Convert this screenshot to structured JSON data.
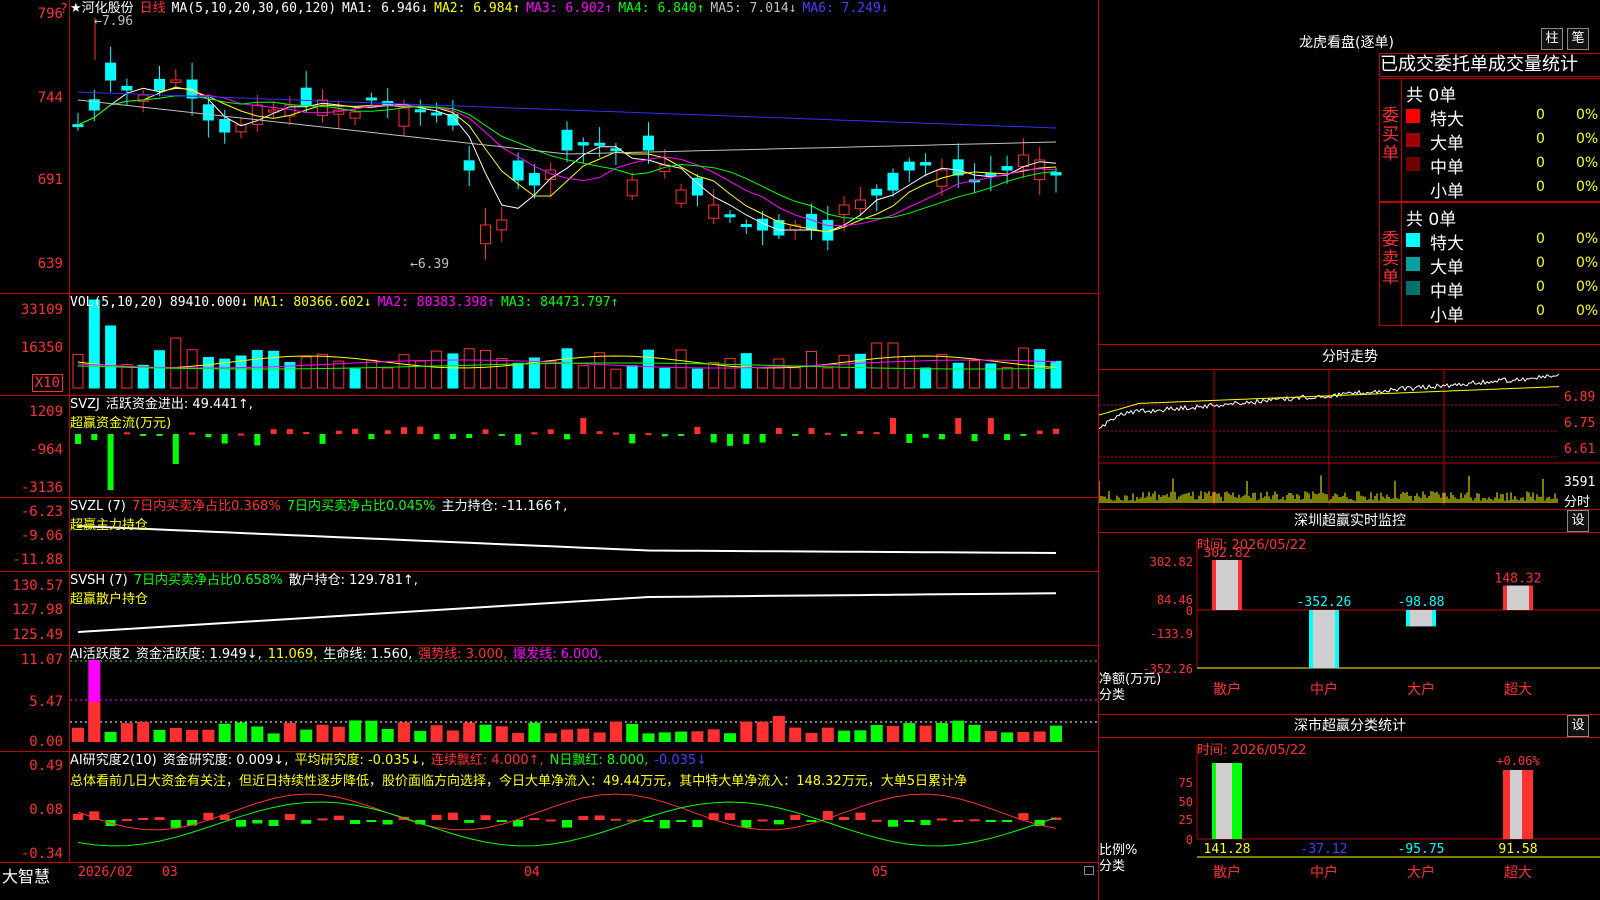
{
  "stock": {
    "name": "★河化股份",
    "period": "日线",
    "ma_label": "MA(5,10,20,30,60,120)",
    "ma": [
      {
        "label": "MA1: 6.946↓",
        "color": "#ffffff"
      },
      {
        "label": "MA2: 6.984↑",
        "color": "#ffff00"
      },
      {
        "label": "MA3: 6.902↑",
        "color": "#ff00ff"
      },
      {
        "label": "MA4: 6.840↑",
        "color": "#00ff00"
      },
      {
        "label": "MA5: 7.014↓",
        "color": "#c0c0c0"
      },
      {
        "label": "MA6: 7.249↓",
        "color": "#4040ff"
      }
    ],
    "price_ticks": [
      "796",
      "744",
      "691",
      "639"
    ],
    "high_note": "←7.96",
    "low_note": "←6.39"
  },
  "vol": {
    "label": "VOL(5,10,20)",
    "value": "89410.000↓",
    "ma": [
      {
        "label": "MA1: 80366.602↓",
        "color": "#ffff00"
      },
      {
        "label": "MA2: 80383.398↑",
        "color": "#ff00ff"
      },
      {
        "label": "MA3: 84473.797↑",
        "color": "#00ff00"
      }
    ],
    "ticks": [
      "33109",
      "16350"
    ],
    "unit": "X10"
  },
  "svzj": {
    "label": "SVZJ",
    "title": "活跃资金进出: 49.441↑,",
    "sub": "超赢资金流(万元)",
    "ticks": [
      "1209",
      "-964",
      "-3136"
    ]
  },
  "svzl": {
    "label": "SVZL (7)",
    "a": "7日内买卖净占比0.368%",
    "b": "7日内买卖净占比0.045%",
    "c": "主力持仓: -11.166↑,",
    "sub": "超赢主力持仓",
    "ticks": [
      "-6.23",
      "-9.06",
      "-11.88"
    ]
  },
  "svsh": {
    "label": "SVSH (7)",
    "a": "7日内买卖净占比0.658%",
    "c": "散户持仓: 129.781↑,",
    "sub": "超赢散户持仓",
    "ticks": [
      "130.57",
      "127.98",
      "125.49"
    ]
  },
  "ai1": {
    "label": "AI活跃度2",
    "a": "资金活跃度: 1.949↓,",
    "b": "11.069,",
    "c": "生命线: 1.560,",
    "d": "强势线: 3.000,",
    "e": "爆发线: 6.000,",
    "ticks": [
      "11.07",
      "5.47",
      "0.00"
    ]
  },
  "ai2": {
    "label": "AI研究度2(10)",
    "a": "资金研究度: 0.009↓,",
    "b": "平均研究度: -0.035↓,",
    "c": "连续飘红: 4.000↑,",
    "d": "N日飘红: 8.000,",
    "e": "-0.035↓",
    "comment": "总体看前几日大资金有关注，但近日持续性逐步降低，股价面临方向选择，今日大单净流入：49.44万元，其中特大单净流入：148.32万元，大单5日累计净",
    "ticks": [
      "0.49",
      "0.08",
      "-0.34"
    ]
  },
  "bottom": {
    "brand": "大智慧",
    "dates": [
      "2026/02",
      "03",
      "04",
      "05"
    ]
  },
  "dragon": {
    "title": "龙虎看盘(逐单)",
    "btn1": "柱",
    "btn2": "笔",
    "subtitle": "已成交委托单成交量统计",
    "buy": {
      "side": "委买单",
      "total": "共 0单",
      "rows": [
        {
          "name": "特大",
          "val": "0",
          "pct": "0%",
          "color": "#ff0000"
        },
        {
          "name": "大单",
          "val": "0",
          "pct": "0%",
          "color": "#a00000"
        },
        {
          "name": "中单",
          "val": "0",
          "pct": "0%",
          "color": "#700000"
        },
        {
          "name": "小单",
          "val": "0",
          "pct": "0%",
          "color": "#000000"
        }
      ]
    },
    "sell": {
      "side": "委卖单",
      "total": "共 0单",
      "rows": [
        {
          "name": "特大",
          "val": "0",
          "pct": "0%",
          "color": "#00ffff"
        },
        {
          "name": "大单",
          "val": "0",
          "pct": "0%",
          "color": "#00a0a0"
        },
        {
          "name": "中单",
          "val": "0",
          "pct": "0%",
          "color": "#007070"
        },
        {
          "name": "小单",
          "val": "0",
          "pct": "0%",
          "color": "#000000"
        }
      ]
    }
  },
  "intraday": {
    "title": "分时走势",
    "ticks": [
      "6.89",
      "6.75",
      "6.61"
    ],
    "vol_tick": "3591",
    "vol_label": "分时"
  },
  "sz_monitor": {
    "title": "深圳超赢实时监控",
    "btn": "设",
    "time": "时间: 2026/05/22",
    "ticks": [
      "302.82",
      "84.46",
      "0",
      "-133.9",
      "-352.26"
    ],
    "ylabel": "净额(万元)",
    "xlabel": "分类",
    "bars": [
      {
        "cat": "散户",
        "val": 302.82,
        "label": "302.82"
      },
      {
        "cat": "中户",
        "val": -352.26,
        "label": "-352.26"
      },
      {
        "cat": "大户",
        "val": -98.88,
        "label": "-98.88"
      },
      {
        "cat": "超大",
        "val": 148.32,
        "label": "148.32"
      }
    ]
  },
  "sz_class": {
    "title": "深市超赢分类统计",
    "btn": "设",
    "time": "时间: 2026/05/22",
    "ticks": [
      "75",
      "50",
      "25",
      "0"
    ],
    "ylabel": "比例%",
    "xlabel": "分类",
    "top_label": "+0.06%",
    "bars": [
      {
        "cat": "散户",
        "label": "141.28"
      },
      {
        "cat": "中户",
        "label": "-37.12"
      },
      {
        "cat": "大户",
        "label": "-95.75"
      },
      {
        "cat": "超大",
        "label": "91.58"
      }
    ]
  }
}
